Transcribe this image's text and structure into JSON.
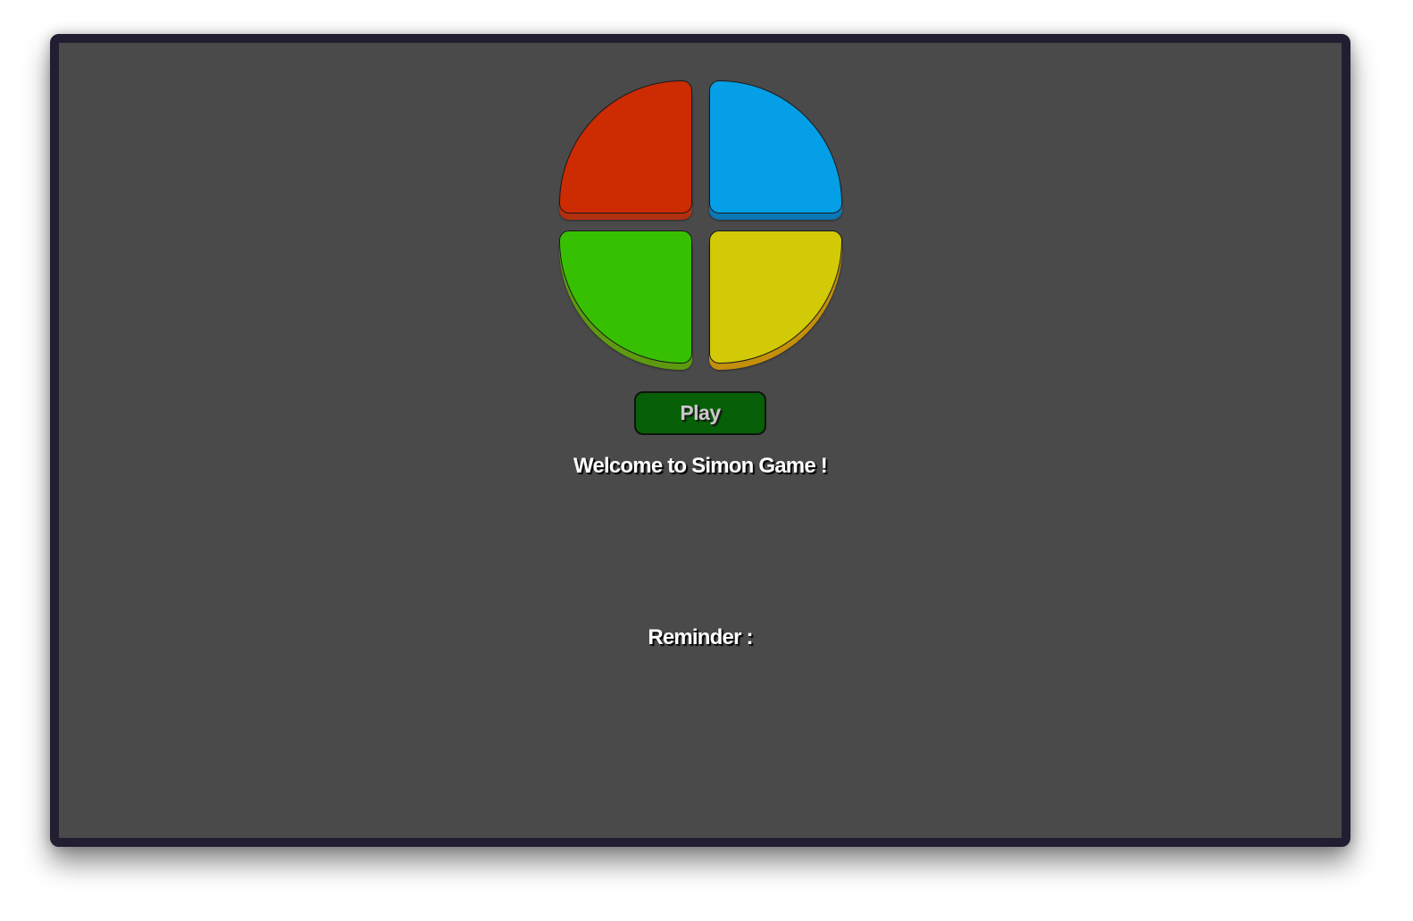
{
  "game": {
    "pads": [
      {
        "name": "red",
        "color": "#cd2b02"
      },
      {
        "name": "blue",
        "color": "#049fe6"
      },
      {
        "name": "green",
        "color": "#37c002"
      },
      {
        "name": "yellow",
        "color": "#d2c907"
      }
    ],
    "play_label": "Play",
    "welcome_text": "Welcome to Simon Game !",
    "reminder_label": "Reminder :"
  },
  "colors": {
    "background": "#4a4a4a",
    "frame": "#231d31",
    "play_button": "#075f08"
  }
}
